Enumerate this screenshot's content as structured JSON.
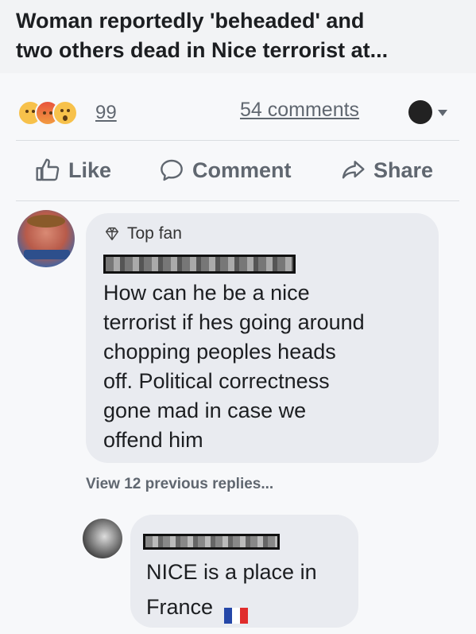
{
  "post": {
    "headline_line1": "Woman reportedly 'beheaded' and",
    "headline_line2": "two others dead in Nice terrorist at..."
  },
  "stats": {
    "reaction_count": "99",
    "comments_count": "54 comments",
    "reaction_icons": [
      "sad-emoji",
      "angry-emoji",
      "wow-emoji"
    ]
  },
  "actions": {
    "like": "Like",
    "comment": "Comment",
    "share": "Share"
  },
  "comment1": {
    "badge": "Top fan",
    "body_lines": [
      "How can he be a nice",
      "terrorist if hes going around",
      "chopping peoples heads",
      "off. Political correctness",
      "gone mad in case we",
      "offend him"
    ]
  },
  "replies": {
    "view_previous": "View 12 previous replies..."
  },
  "comment2": {
    "body_line1": "NICE is a place in",
    "body_line2": "France",
    "flag_colors": [
      "#2547a8",
      "#ffffff",
      "#e02c2c"
    ]
  },
  "colors": {
    "muted_text": "#606770",
    "bubble_bg": "#e9ebf0"
  }
}
